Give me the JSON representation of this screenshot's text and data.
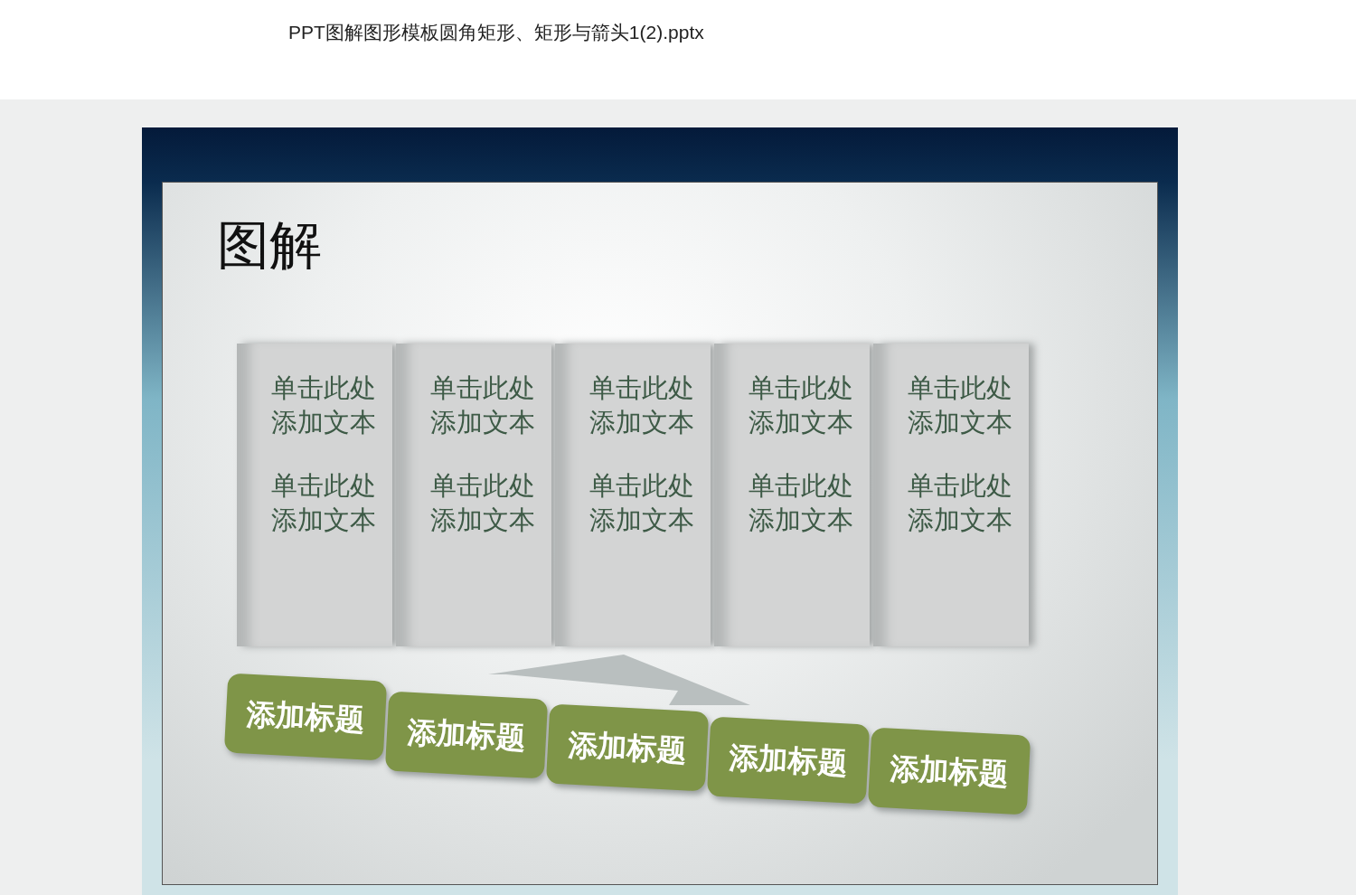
{
  "document": {
    "file_name": "PPT图解图形模板圆角矩形、矩形与箭头1(2).pptx"
  },
  "slide": {
    "title": "图解",
    "columns": [
      {
        "texts": [
          "单击此处添加文本",
          "单击此处添加文本"
        ]
      },
      {
        "texts": [
          "单击此处添加文本",
          "单击此处添加文本"
        ]
      },
      {
        "texts": [
          "单击此处添加文本",
          "单击此处添加文本"
        ]
      },
      {
        "texts": [
          "单击此处添加文本",
          "单击此处添加文本"
        ]
      },
      {
        "texts": [
          "单击此处添加文本",
          "单击此处添加文本"
        ]
      }
    ],
    "headings": [
      "添加标题",
      "添加标题",
      "添加标题",
      "添加标题",
      "添加标题"
    ]
  }
}
